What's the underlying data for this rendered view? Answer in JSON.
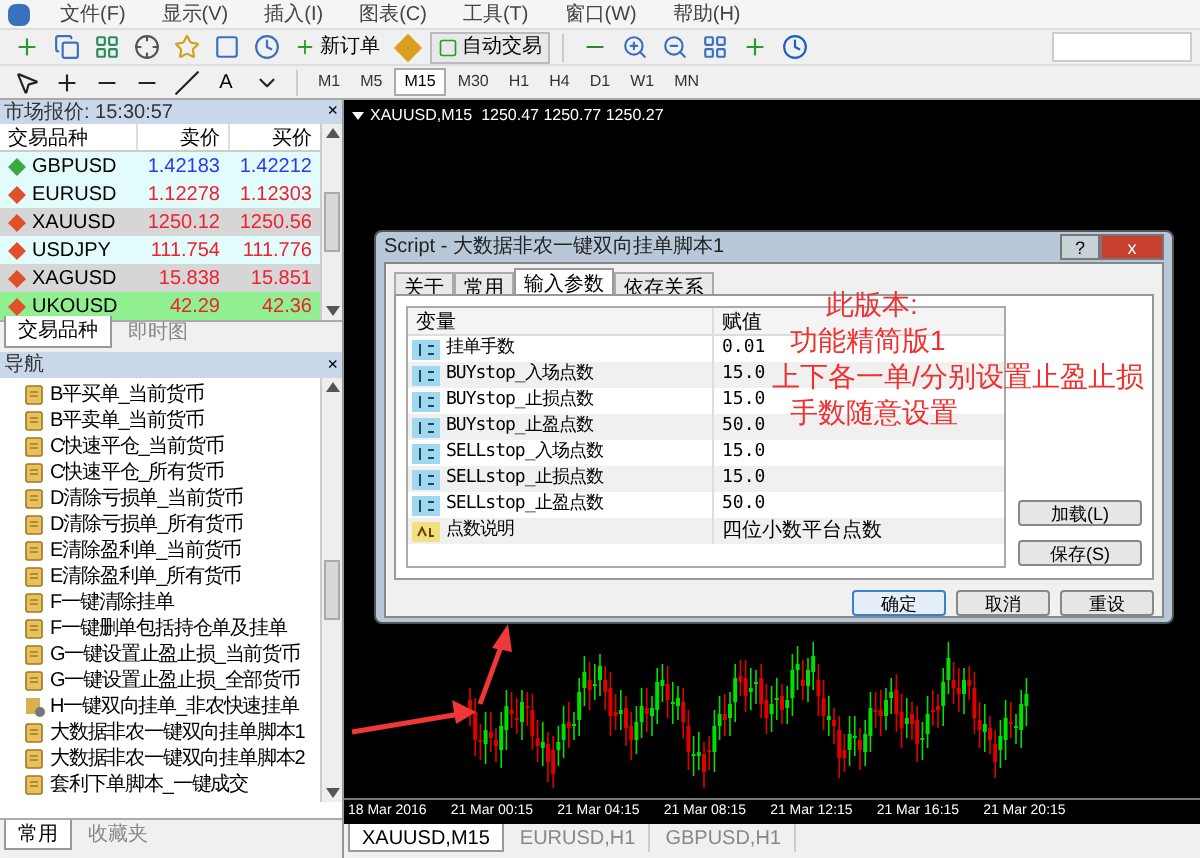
{
  "menu": [
    "文件(F)",
    "显示(V)",
    "插入(I)",
    "图表(C)",
    "工具(T)",
    "窗口(W)",
    "帮助(H)"
  ],
  "toolbar": {
    "new_order": "新订单",
    "auto_trade": "自动交易"
  },
  "drawing_toolbar": {
    "text_tool": "A"
  },
  "timeframes": [
    {
      "label": "M1",
      "selected": false
    },
    {
      "label": "M5",
      "selected": false
    },
    {
      "label": "M15",
      "selected": true
    },
    {
      "label": "M30",
      "selected": false
    },
    {
      "label": "H1",
      "selected": false
    },
    {
      "label": "H4",
      "selected": false
    },
    {
      "label": "D1",
      "selected": false
    },
    {
      "label": "W1",
      "selected": false
    },
    {
      "label": "MN",
      "selected": false
    }
  ],
  "market_watch": {
    "title": "市场报价: 15:30:57",
    "close": "×",
    "columns": [
      "交易品种",
      "卖价",
      "买价"
    ],
    "rows": [
      {
        "symbol": "GBPUSD",
        "bid": "1.42183",
        "ask": "1.42212",
        "kind": "up",
        "color": "#e2fbfb"
      },
      {
        "symbol": "EURUSD",
        "bid": "1.12278",
        "ask": "1.12303",
        "kind": "down",
        "color": "#e2fbfb"
      },
      {
        "symbol": "XAUUSD",
        "bid": "1250.12",
        "ask": "1250.56",
        "kind": "down",
        "color": "#d6d6d6"
      },
      {
        "symbol": "USDJPY",
        "bid": "111.754",
        "ask": "111.776",
        "kind": "down",
        "color": "#e2fbfb"
      },
      {
        "symbol": "XAGUSD",
        "bid": "15.838",
        "ask": "15.851",
        "kind": "down",
        "color": "#d6d6d6"
      },
      {
        "symbol": "UKOUSD",
        "bid": "42.29",
        "ask": "42.36",
        "kind": "down",
        "color": "#90f090"
      }
    ],
    "tabs": [
      {
        "label": "交易品种",
        "selected": true
      },
      {
        "label": "即时图",
        "selected": false
      }
    ]
  },
  "navigator": {
    "title": "导航",
    "close": "×",
    "items": [
      {
        "label": "B平买单_当前货币",
        "kind": "script"
      },
      {
        "label": "B平卖单_当前货币",
        "kind": "script"
      },
      {
        "label": "C快速平仓_当前货币",
        "kind": "script"
      },
      {
        "label": "C快速平仓_所有货币",
        "kind": "script"
      },
      {
        "label": "D清除亏损单_当前货币",
        "kind": "script"
      },
      {
        "label": "D清除亏损单_所有货币",
        "kind": "script"
      },
      {
        "label": "E清除盈利单_当前货币",
        "kind": "script"
      },
      {
        "label": "E清除盈利单_所有货币",
        "kind": "script"
      },
      {
        "label": "F一键清除挂单",
        "kind": "script"
      },
      {
        "label": "F一键删单包括持仓单及挂单",
        "kind": "script"
      },
      {
        "label": "G一键设置止盈止损_当前货币",
        "kind": "script"
      },
      {
        "label": "G一键设置止盈止损_全部货币",
        "kind": "script"
      },
      {
        "label": "H一键双向挂单_非农快速挂单",
        "kind": "gear"
      },
      {
        "label": "大数据非农一键双向挂单脚本1",
        "kind": "script"
      },
      {
        "label": "大数据非农一键双向挂单脚本2",
        "kind": "script"
      },
      {
        "label": "套利下单脚本_一键成交",
        "kind": "script"
      }
    ],
    "tabs": [
      {
        "label": "常用",
        "selected": true
      },
      {
        "label": "收藏夹",
        "selected": false
      }
    ]
  },
  "chart": {
    "header": "XAUUSD,M15  1250.47 1250.77 1250.27",
    "time_labels": [
      "18 Mar 2016",
      "21 Mar 00:15",
      "21 Mar 04:15",
      "21 Mar 08:15",
      "21 Mar 12:15",
      "21 Mar 16:15",
      "21 Mar 20:15"
    ],
    "tabs": [
      {
        "label": "XAUUSD,M15",
        "selected": true
      },
      {
        "label": "EURUSD,H1",
        "selected": false
      },
      {
        "label": "GBPUSD,H1",
        "selected": false
      }
    ]
  },
  "dialog": {
    "title": "Script - 大数据非农一键双向挂单脚本1",
    "help": "?",
    "close": "x",
    "tabs": [
      {
        "label": "关于",
        "selected": false
      },
      {
        "label": "常用",
        "selected": false
      },
      {
        "label": "输入参数",
        "selected": true
      },
      {
        "label": "依存关系",
        "selected": false
      }
    ],
    "columns": [
      "变量",
      "赋值"
    ],
    "params": [
      {
        "name": "挂单手数",
        "value": "0.01",
        "kind": "number"
      },
      {
        "name": "BUYstop_入场点数",
        "value": "15.0",
        "kind": "number"
      },
      {
        "name": "BUYstop_止损点数",
        "value": "15.0",
        "kind": "number"
      },
      {
        "name": "BUYstop_止盈点数",
        "value": "50.0",
        "kind": "number"
      },
      {
        "name": "SELLstop_入场点数",
        "value": "15.0",
        "kind": "number"
      },
      {
        "name": "SELLstop_止损点数",
        "value": "15.0",
        "kind": "number"
      },
      {
        "name": "SELLstop_止盈点数",
        "value": "50.0",
        "kind": "number"
      },
      {
        "name": "点数说明",
        "value": "四位小数平台点数",
        "kind": "text"
      }
    ],
    "side_buttons": [
      "加载(L)",
      "保存(S)"
    ],
    "buttons": [
      "确定",
      "取消",
      "重设"
    ],
    "annotation": [
      "此版本:",
      "功能精简版1",
      "上下各一单/分别设置止盈止损",
      "手数随意设置"
    ]
  }
}
